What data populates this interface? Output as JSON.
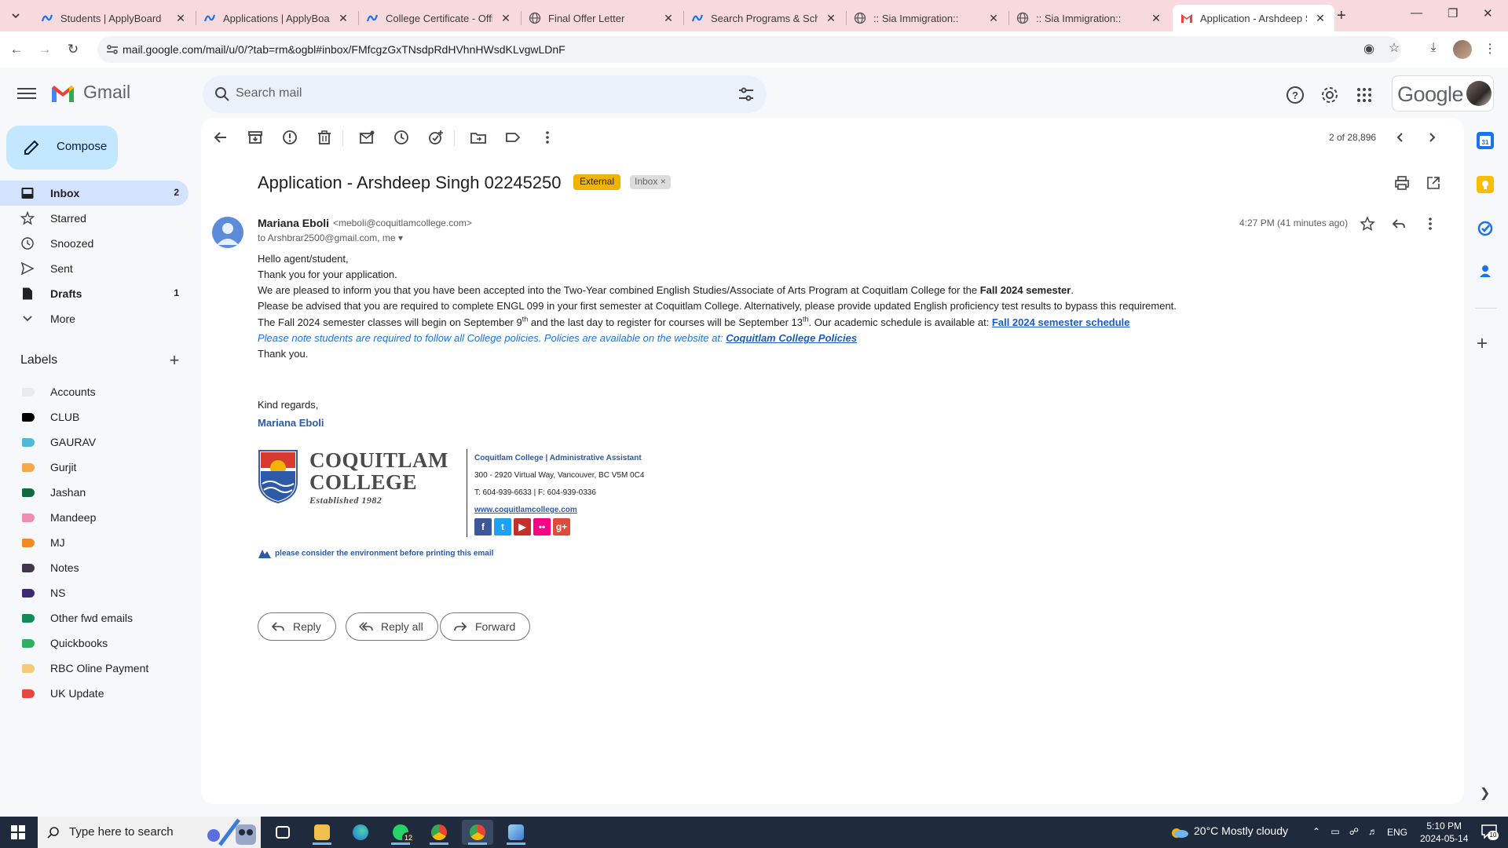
{
  "browser": {
    "tabs": [
      {
        "title": "Students | ApplyBoard",
        "icon": "applyboard-icon"
      },
      {
        "title": "Applications | ApplyBoard",
        "icon": "applyboard-icon"
      },
      {
        "title": "College Certificate - Offic",
        "icon": "applyboard-icon"
      },
      {
        "title": "Final Offer Letter",
        "icon": "globe-icon"
      },
      {
        "title": "Search Programs & Schoo",
        "icon": "applyboard-icon"
      },
      {
        "title": ":: Sia Immigration::",
        "icon": "globe-icon"
      },
      {
        "title": ":: Sia Immigration::",
        "icon": "globe-icon"
      },
      {
        "title": "Application - Arshdeep Si",
        "icon": "gmail-icon"
      }
    ],
    "url": "mail.google.com/mail/u/0/?tab=rm&ogbl#inbox/FMfcgzGxTNsdpRdHVhnHWsdKLvgwLDnF"
  },
  "gmail": {
    "app_name": "Gmail",
    "search_placeholder": "Search mail",
    "google_wordmark": "Google",
    "compose_label": "Compose",
    "nav": [
      {
        "label": "Inbox",
        "count": "2",
        "icon": "inbox-icon"
      },
      {
        "label": "Starred",
        "count": "",
        "icon": "star-icon"
      },
      {
        "label": "Snoozed",
        "count": "",
        "icon": "clock-icon"
      },
      {
        "label": "Sent",
        "count": "",
        "icon": "send-icon"
      },
      {
        "label": "Drafts",
        "count": "1",
        "icon": "draft-icon"
      },
      {
        "label": "More",
        "count": "",
        "icon": "chevron-down-icon"
      }
    ],
    "labels_heading": "Labels",
    "labels": [
      {
        "name": "Accounts",
        "color": "#e8eaed"
      },
      {
        "name": "CLUB",
        "color": "#000000"
      },
      {
        "name": "GAURAV",
        "color": "#4fb8d6"
      },
      {
        "name": "Gurjit",
        "color": "#f2a94e"
      },
      {
        "name": "Jashan",
        "color": "#0f6b3f"
      },
      {
        "name": "Mandeep",
        "color": "#f08cae"
      },
      {
        "name": "MJ",
        "color": "#f08a24"
      },
      {
        "name": "Notes",
        "color": "#41364a"
      },
      {
        "name": "NS",
        "color": "#3d2a73"
      },
      {
        "name": "Other fwd emails",
        "color": "#14895a"
      },
      {
        "name": "Quickbooks",
        "color": "#2eaf62"
      },
      {
        "name": "RBC Oline Payment",
        "color": "#f5c97a"
      },
      {
        "name": "UK Update",
        "color": "#e8453c"
      }
    ],
    "pager": "2 of 28,896",
    "email": {
      "subject": "Application - Arshdeep Singh 02245250",
      "chip_external": "External",
      "chip_inbox": "Inbox",
      "sender_name": "Mariana Eboli",
      "sender_email": "<meboli@coquitlamcollege.com>",
      "to_line": "to Arshbrar2500@gmail.com, me",
      "time": "4:27 PM (41 minutes ago)",
      "body": {
        "greeting": "Hello agent/student,",
        "thanks": "Thank you for your application.",
        "accepted_pre": "We are pleased to inform you that you have been accepted into the Two-Year combined English Studies/Associate of Arts Program at Coquitlam College for the ",
        "accepted_bold": "Fall 2024 semester",
        "accepted_post": ".",
        "advised": "Please be advised that you are required to complete ENGL 099 in your first semester at Coquitlam College. Alternatively, please provide updated English proficiency test results to bypass this requirement.",
        "begin_1": "The Fall 2024 semester classes will begin on September 9",
        "begin_sup1": "th",
        "begin_2": " and the last day to register for courses will be September 13",
        "begin_sup2": "th",
        "begin_3": ". Our academic schedule is available at: ",
        "schedule_link": "Fall 2024 semester schedule",
        "policy_text": "Please note students are required to follow all College policies. Policies are available on the website at: ",
        "policy_link": "Coquitlam College Policies",
        "closing": "Thank you.",
        "regards": "Kind regards,",
        "signature_name": "Mariana Eboli"
      },
      "signature": {
        "logo_line1": "COQUITLAM",
        "logo_line2": "COLLEGE",
        "logo_est": "Established 1982",
        "title": "Coquitlam College | Administrative Assistant",
        "address": "300 - 2920 Virtual Way, Vancouver, BC V5M 0C4",
        "phone": "T: 604-939-6633 | F: 604-939-0336",
        "website": "www.coquitlamcollege.com",
        "env": "please consider the environment before printing this email"
      },
      "actions": {
        "reply": "Reply",
        "reply_all": "Reply all",
        "forward": "Forward"
      }
    }
  },
  "taskbar": {
    "search_placeholder": "Type here to search",
    "whatsapp_badge": "12",
    "weather": "20°C  Mostly cloudy",
    "lang": "ENG",
    "time": "5:10 PM",
    "date": "2024-05-14",
    "notif_count": "10"
  }
}
